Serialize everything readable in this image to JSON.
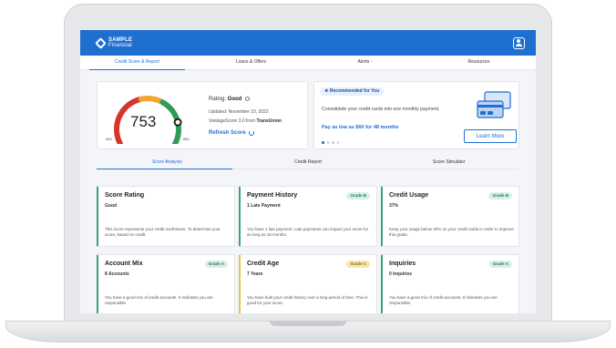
{
  "app": {
    "brand_name": "SAMPLE",
    "brand_sub": "Financial"
  },
  "top_tabs": [
    {
      "label": "Credit Score & Report",
      "active": true
    },
    {
      "label": "Loans & Offers",
      "active": false
    },
    {
      "label": "Alerts",
      "active": false,
      "dot": "•"
    },
    {
      "label": "Resources",
      "active": false
    }
  ],
  "score": {
    "value": "753",
    "min": "300",
    "max": "850",
    "rating_label": "Rating:",
    "rating_value": "Good",
    "updated": "Updated: November 10, 2022",
    "source_prefix": "VantageScore 3.0 from",
    "source_bureau": "TransUnion",
    "refresh_label": "Refresh Score",
    "gauge_fraction": 0.82,
    "colors": {
      "low": "#d9342b",
      "mid": "#f0a531",
      "high": "#2e9b56",
      "needle": "#222222"
    }
  },
  "recommendation": {
    "pill": "Recommended for You",
    "text": "Consolidate your credit cards into one monthly payment.",
    "offer": "Pay as low as $60 for 48 months",
    "button": "Learn More",
    "carousel_active": 0,
    "carousel_count": 4
  },
  "sub_tabs": [
    {
      "label": "Score Analysis",
      "active": true
    },
    {
      "label": "Credit Report",
      "active": false
    },
    {
      "label": "Score Simulator",
      "active": false
    }
  ],
  "factors": [
    {
      "title": "Score Rating",
      "value": "Good",
      "grade": "",
      "desc": "This score represents your credit worthiness. To determine your score, based on credit."
    },
    {
      "title": "Payment History",
      "value": "1 Late Payment",
      "grade": "Grade B",
      "desc": "You have 1 late payment. Late payments can impact your score for as long as 18 months."
    },
    {
      "title": "Credit Usage",
      "value": "37%",
      "grade": "Grade B",
      "desc": "Keep your usage below 30% on your credit cards in order to improve this grade."
    },
    {
      "title": "Account Mix",
      "value": "8 Accounts",
      "grade": "Grade A",
      "desc": "You have a good mix of credit accounts. It indicates you are responsible."
    },
    {
      "title": "Credit Age",
      "value": "7 Years",
      "grade": "Grade C",
      "desc": "You have built your credit history over a long period of time. This is good for your score."
    },
    {
      "title": "Inquiries",
      "value": "0 Inquiries",
      "grade": "Grade A",
      "desc": "You have a good mix of credit accounts. It indicates you are responsible."
    }
  ]
}
